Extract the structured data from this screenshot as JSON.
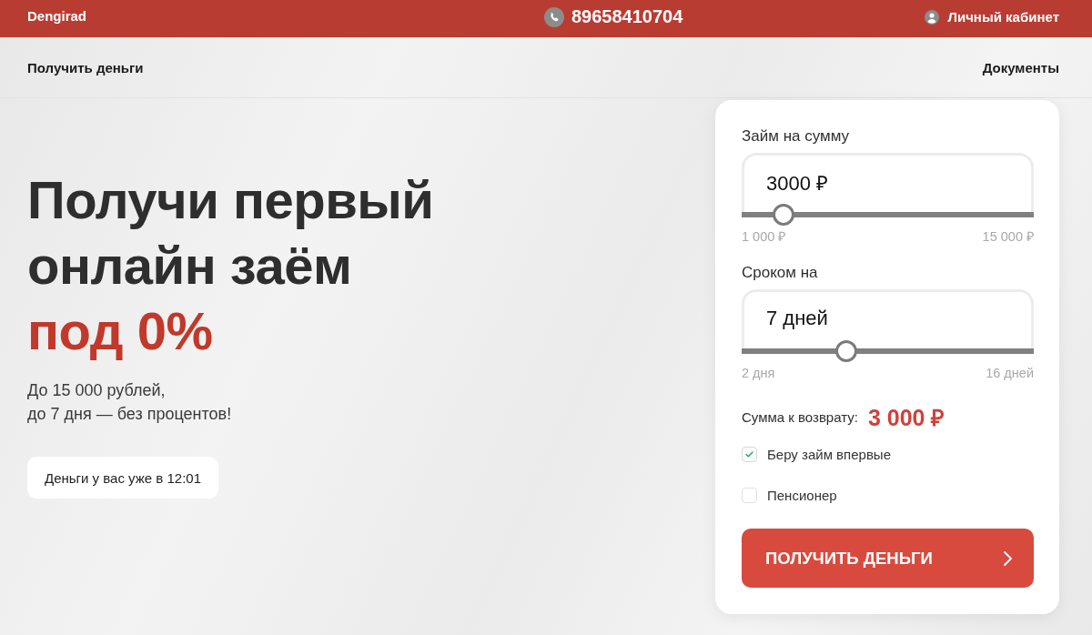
{
  "header": {
    "logo": "Dengirad",
    "phone": "89658410704",
    "account_link": "Личный кабинет"
  },
  "nav": {
    "left_link": "Получить деньги",
    "right_link": "Документы"
  },
  "hero": {
    "title_lines": [
      "Получи первый",
      "онлайн заём"
    ],
    "title_accent": "под 0%",
    "subtitle_lines": [
      "До 15 000 рублей,",
      "до 7 дня — без процентов!"
    ],
    "badge": "Деньги у вас уже в 12:01"
  },
  "calculator": {
    "sliders": [
      {
        "label": "Займ на сумму",
        "value": "3000 ₽",
        "level": 0.143,
        "min_label": "1 000 ₽",
        "max_label": "15 000 ₽"
      },
      {
        "label": "Сроком на",
        "value": "7 дней",
        "level": 0.357,
        "min_label": "2 дня",
        "max_label": "16 дней"
      }
    ],
    "total": {
      "label": "Сумма к возврату:",
      "value": "3 000 ₽"
    },
    "options": [
      {
        "label": "Беру займ впервые",
        "checked": true
      },
      {
        "label": "Пенсионер",
        "checked": false
      }
    ],
    "submit_button": "ПОЛУЧИТЬ ДЕНЬГИ"
  }
}
